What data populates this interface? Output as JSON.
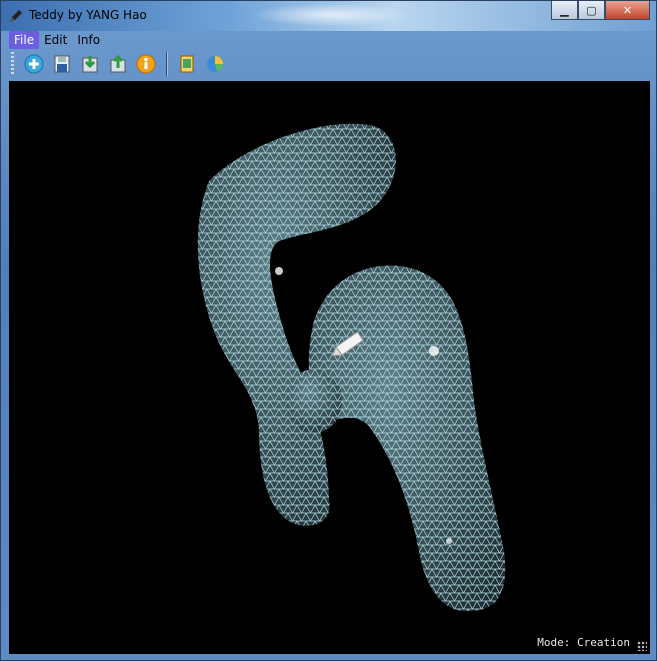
{
  "window": {
    "title": "Teddy by YANG Hao"
  },
  "window_controls": {
    "minimize": "▁",
    "maximize": "▢",
    "close": "✕"
  },
  "menu": [
    {
      "label": "File",
      "active": true
    },
    {
      "label": "Edit",
      "active": false
    },
    {
      "label": "Info",
      "active": false
    }
  ],
  "toolbar": {
    "icons": [
      "new-icon",
      "save-icon",
      "import-icon",
      "export-icon",
      "info-icon",
      "screenshot-icon",
      "stats-icon"
    ]
  },
  "status": {
    "mode_text": "Mode: Creation"
  },
  "colors": {
    "mesh": "#bfe6f2",
    "background": "#000000",
    "menu_active": "#6b5fe0"
  }
}
